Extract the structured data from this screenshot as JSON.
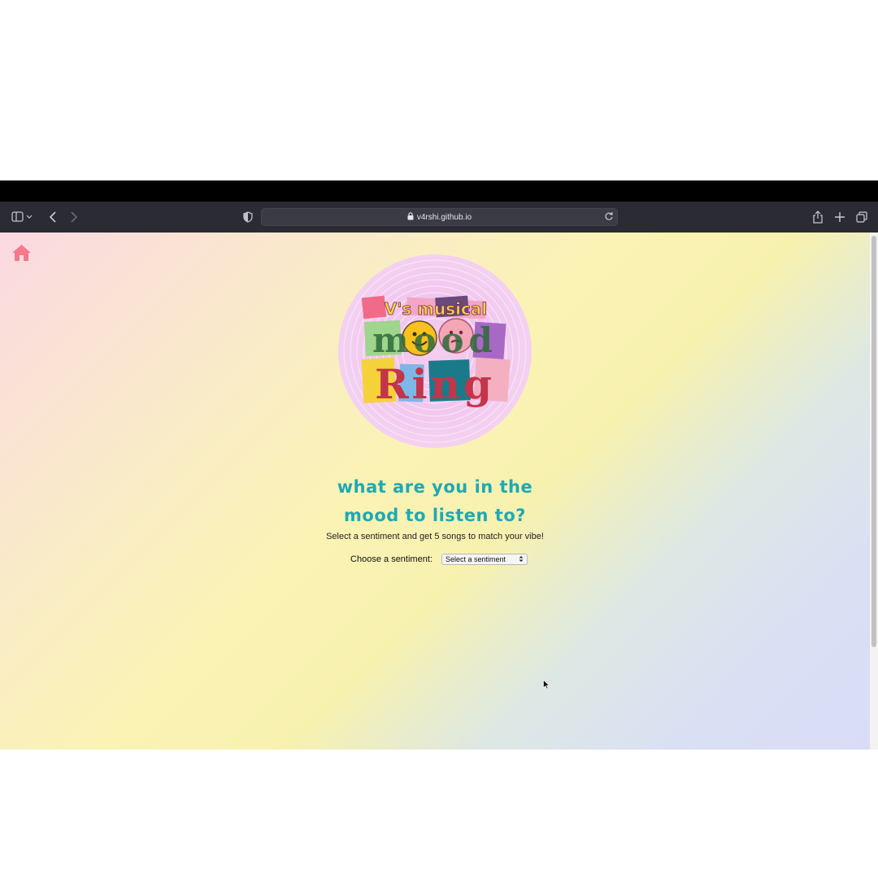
{
  "browser": {
    "url": "v4rshi.github.io",
    "icons": {
      "sidebar": "sidebar-icon",
      "back": "chevron-left-icon",
      "forward": "chevron-right-icon",
      "privacy": "shield-icon",
      "lock": "lock-icon",
      "reload": "reload-icon",
      "share": "share-icon",
      "new_tab": "plus-icon",
      "tabs": "tabs-overview-icon"
    }
  },
  "page": {
    "home_icon": "home-icon",
    "logo": {
      "line1": "V's musical",
      "line2": "mood",
      "line3": "Ring"
    },
    "heading_line1": "what are you in the",
    "heading_line2": "mood to listen to?",
    "subtitle": "Select a sentiment and get 5 songs to match your vibe!",
    "choose_label": "Choose a sentiment:",
    "select_value": "Select a sentiment"
  },
  "colors": {
    "accent_heading": "#1fa9b3",
    "home": "#f47a8c"
  }
}
